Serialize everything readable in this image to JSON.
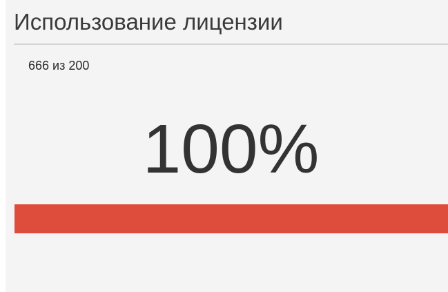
{
  "widget": {
    "title": "Использование лицензии",
    "usage_text": "666 из 200",
    "percent_label": "100%",
    "progress_fraction": 1.0,
    "progress_color": "#de4c3b"
  }
}
